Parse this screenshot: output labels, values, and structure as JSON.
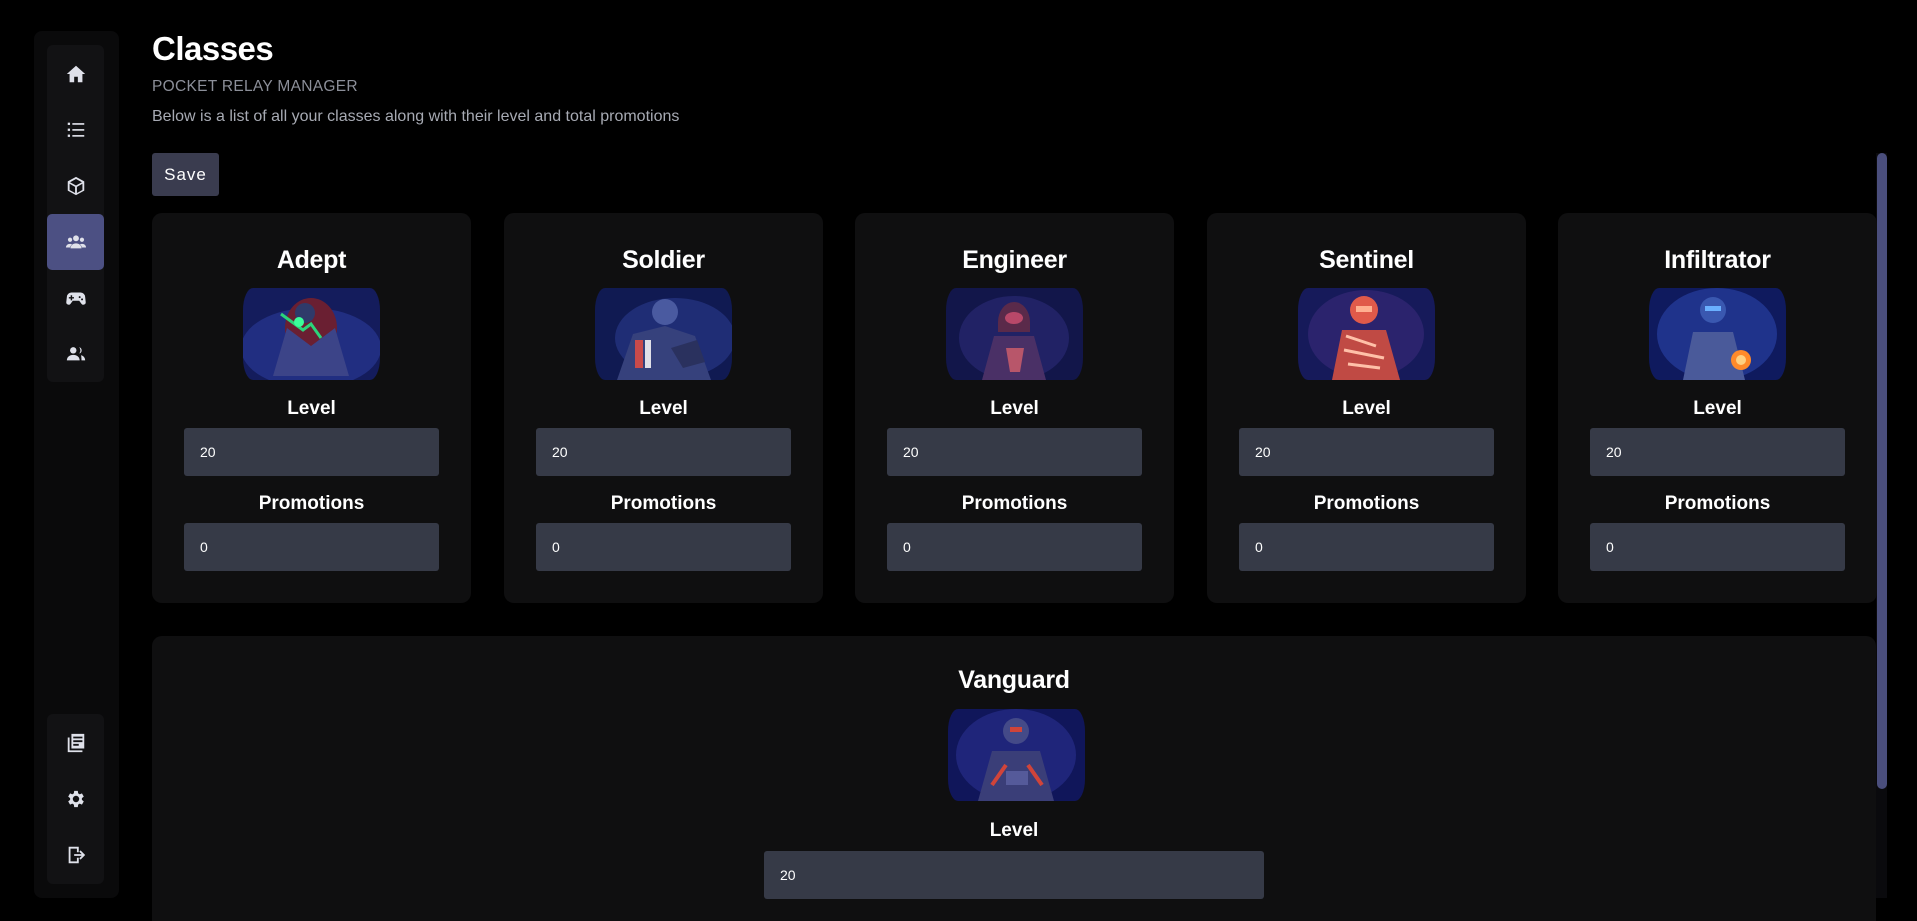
{
  "page": {
    "title": "Classes",
    "subtitle": "POCKET RELAY MANAGER",
    "description": "Below is a list of all your classes along with their level and total promotions"
  },
  "toolbar": {
    "save_label": "Save"
  },
  "sidebar": {
    "top_items": [
      {
        "icon": "home-icon",
        "active": false
      },
      {
        "icon": "list-icon",
        "active": false
      },
      {
        "icon": "cube-icon",
        "active": false
      },
      {
        "icon": "users-icon",
        "active": true
      },
      {
        "icon": "gamepad-icon",
        "active": false
      },
      {
        "icon": "players-icon",
        "active": false
      }
    ],
    "bottom_items": [
      {
        "icon": "logs-icon"
      },
      {
        "icon": "gear-icon"
      },
      {
        "icon": "logout-icon"
      }
    ],
    "active_color": "#4c5083"
  },
  "fields": {
    "level_label": "Level",
    "promotions_label": "Promotions"
  },
  "classes": [
    {
      "name": "Adept",
      "level": "20",
      "promotions": "0",
      "accent": "#2bd47a"
    },
    {
      "name": "Soldier",
      "level": "20",
      "promotions": "0",
      "accent": "#c94a4a"
    },
    {
      "name": "Engineer",
      "level": "20",
      "promotions": "0",
      "accent": "#b8566a"
    },
    {
      "name": "Sentinel",
      "level": "20",
      "promotions": "0",
      "accent": "#ff6a4d"
    },
    {
      "name": "Infiltrator",
      "level": "20",
      "promotions": "0",
      "accent": "#ff8a2a"
    },
    {
      "name": "Vanguard",
      "level": "20",
      "accent": "#d0443a"
    }
  ],
  "colors": {
    "card_bg": "#0f0f10",
    "input_bg": "#363a47",
    "scrollbar": "#4a4e7c"
  }
}
